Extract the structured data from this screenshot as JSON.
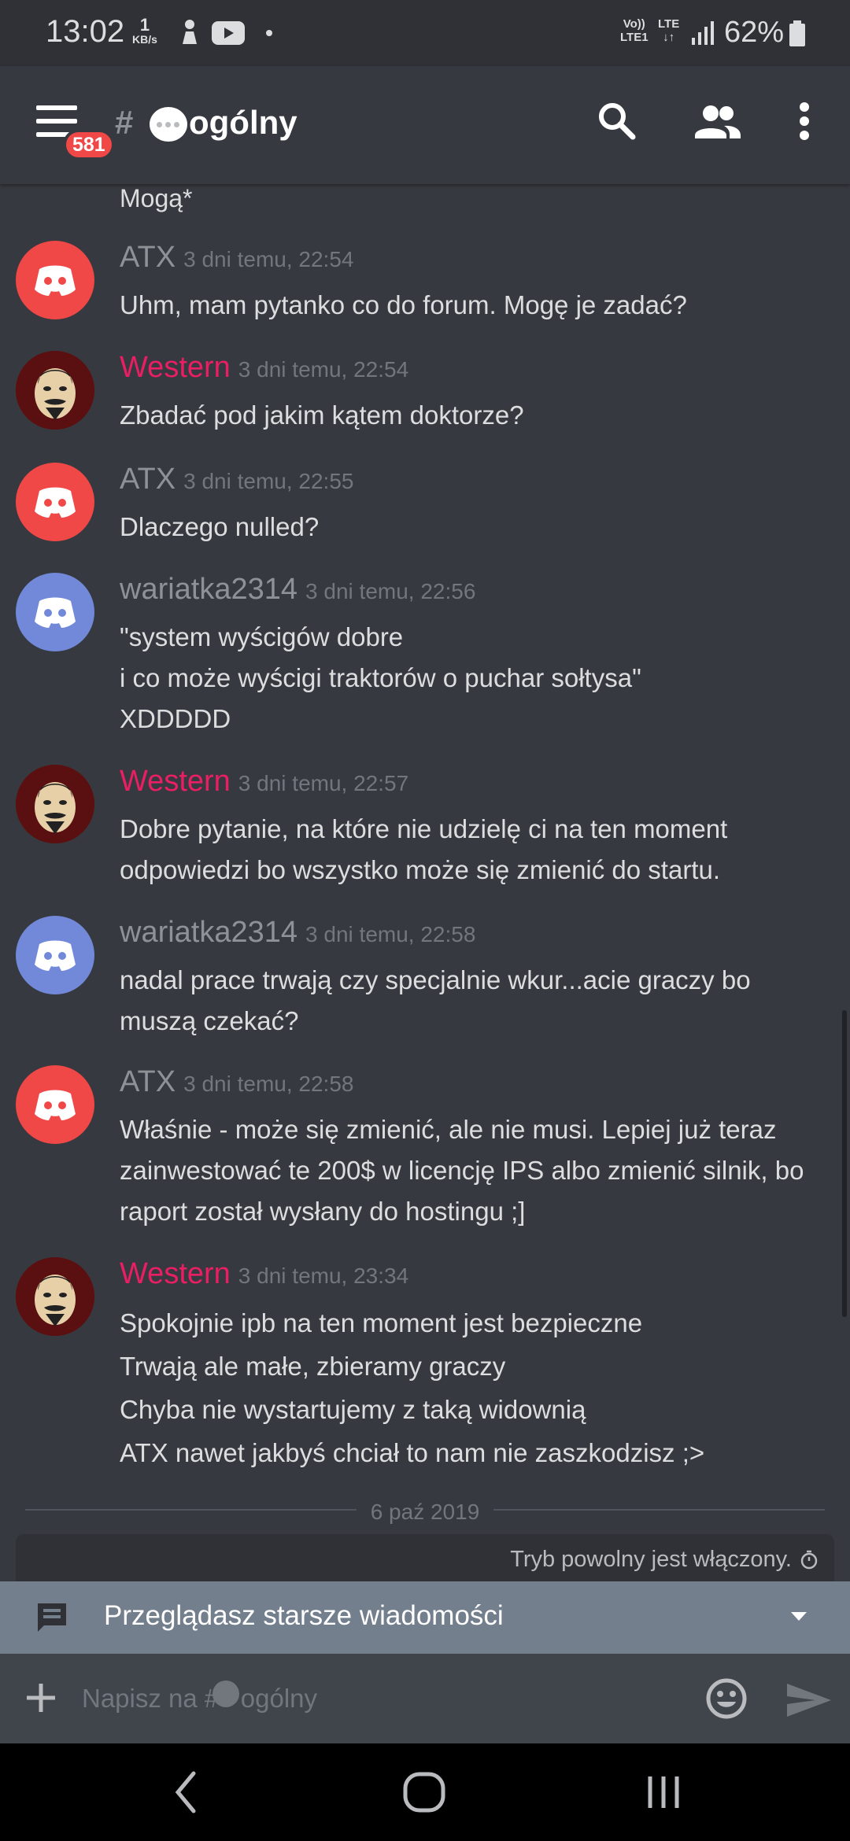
{
  "status_bar": {
    "time": "13:02",
    "kbs_value": "1",
    "kbs_unit": "KB/s",
    "volte": "Vo))",
    "lte1": "LTE1",
    "lte": "LTE",
    "battery": "62%"
  },
  "header": {
    "badge": "581",
    "hash": "#",
    "channel_name": "ogólny"
  },
  "messages": {
    "continuation": "Mogą*",
    "list": [
      {
        "author": "ATX",
        "author_color": "#8e9297",
        "timestamp": "3 dni temu, 22:54",
        "avatar": "red",
        "lines": [
          "Uhm, mam pytanko co do forum. Mogę je zadać?"
        ]
      },
      {
        "author": "Western",
        "author_color": "#e91e63",
        "timestamp": "3 dni temu, 22:54",
        "avatar": "mask",
        "lines": [
          "Zbadać pod jakim kątem doktorze?"
        ]
      },
      {
        "author": "ATX",
        "author_color": "#8e9297",
        "timestamp": "3 dni temu, 22:55",
        "avatar": "red",
        "lines": [
          "Dlaczego nulled?"
        ]
      },
      {
        "author": "wariatka2314",
        "author_color": "#8e9297",
        "timestamp": "3 dni temu, 22:56",
        "avatar": "blue",
        "lines": [
          "\"system wyścigów dobre",
          "i co może wyścigi traktorów o puchar sołtysa\"",
          "XDDDDD"
        ]
      },
      {
        "author": "Western",
        "author_color": "#e91e63",
        "timestamp": "3 dni temu, 22:57",
        "avatar": "mask",
        "lines": [
          "Dobre pytanie, na które nie udzielę ci na ten moment",
          "odpowiedzi bo wszystko może się zmienić do startu."
        ]
      },
      {
        "author": "wariatka2314",
        "author_color": "#8e9297",
        "timestamp": "3 dni temu, 22:58",
        "avatar": "blue",
        "lines": [
          "nadal prace trwają czy specjalnie wkur...acie graczy bo",
          "muszą czekać?"
        ]
      },
      {
        "author": "ATX",
        "author_color": "#8e9297",
        "timestamp": "3 dni temu, 22:58",
        "avatar": "red",
        "lines": [
          "Właśnie - może się zmienić, ale nie musi. Lepiej już teraz",
          "zainwestować te 200$ w licencję IPS albo zmienić silnik, bo",
          "raport został wysłany do hostingu ;]"
        ]
      },
      {
        "author": "Western",
        "author_color": "#e91e63",
        "timestamp": "3 dni temu, 23:34",
        "avatar": "mask",
        "lines": [
          "Spokojnie ipb na ten moment jest bezpieczne",
          "Trwają ale małe, zbieramy graczy",
          "Chyba nie wystartujemy z taką widownią",
          "ATX nawet jakbyś chciał to nam nie zaszkodzisz ;>"
        ]
      }
    ],
    "date_divider": "6 paź 2019",
    "slowmode": "Tryb powolny jest włączony."
  },
  "older_bar": {
    "text": "Przeglądasz starsze wiadomości"
  },
  "composer": {
    "placeholder": "Napisz na #   ogólny"
  },
  "icons": {
    "menu": "hamburger-icon",
    "search": "search-icon",
    "members": "members-icon",
    "more": "more-vertical-icon",
    "chat": "chat-bubble-icon",
    "chevron": "chevron-down-icon",
    "plus": "plus-icon",
    "emoji": "emoji-icon",
    "send": "send-icon",
    "clock": "clock-icon"
  },
  "colors": {
    "background": "#36393f",
    "accent_red": "#f04747",
    "blurple": "#7289da",
    "western": "#e91e63"
  }
}
